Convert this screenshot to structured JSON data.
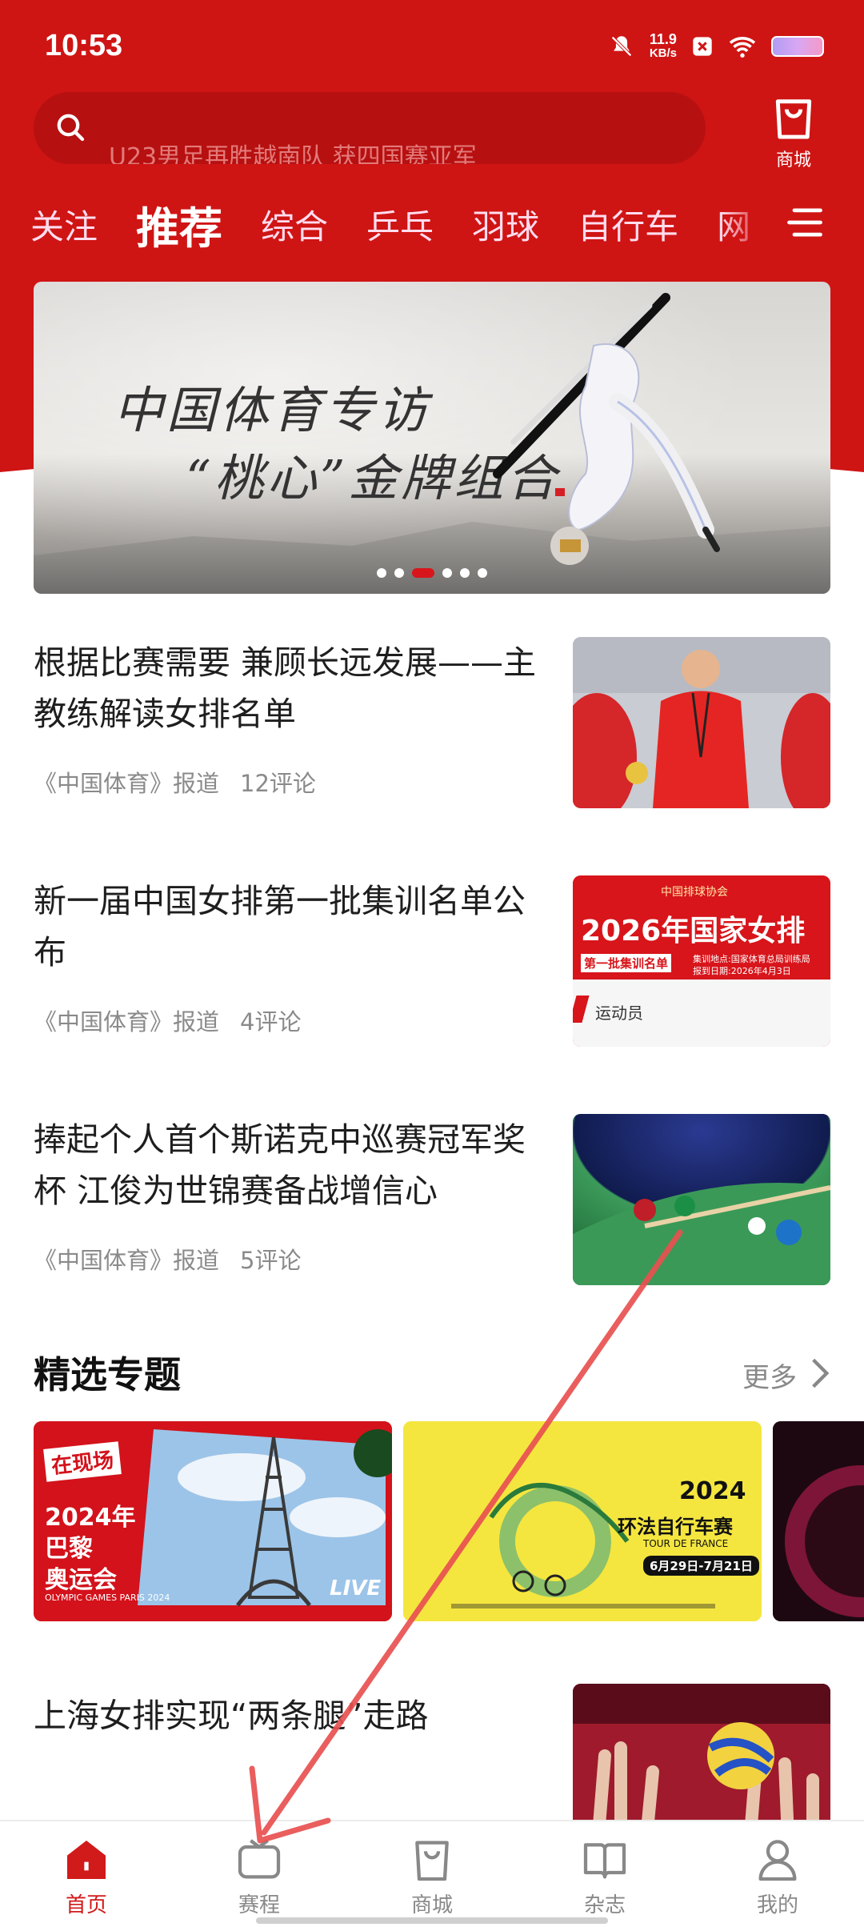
{
  "status_bar": {
    "time": "10:53",
    "net_speed_value": "11.9",
    "net_speed_unit": "KB/s",
    "icons": [
      "mute-icon",
      "network-speed",
      "x-notification-icon",
      "wifi-icon",
      "battery-icon"
    ]
  },
  "search": {
    "placeholder": "U23男足再胜越南队 获四国赛亚军",
    "icon": "search-icon"
  },
  "shop_top": {
    "label": "商城",
    "icon": "shopping-bag-icon"
  },
  "tabs": [
    {
      "label": "关注",
      "active": false
    },
    {
      "label": "推荐",
      "active": true
    },
    {
      "label": "综合",
      "active": false
    },
    {
      "label": "乒乓",
      "active": false
    },
    {
      "label": "羽球",
      "active": false
    },
    {
      "label": "自行车",
      "active": false
    },
    {
      "label": "网",
      "active": false
    }
  ],
  "banner": {
    "line1": "中国体育专访",
    "line2": "“桃心”金牌组合",
    "dots_count": 6,
    "active_dot": 2
  },
  "articles": [
    {
      "title": "根据比赛需要 兼顾长远发展——主教练解读女排名单",
      "source": "《中国体育》报道",
      "comments": "12评论"
    },
    {
      "title": "新一届中国女排第一批集训名单公布",
      "source": "《中国体育》报道",
      "comments": "4评论"
    },
    {
      "title": "捧起个人首个斯诺克中巡赛冠军奖杯 江俊为世锦赛备战增信心",
      "source": "《中国体育》报道",
      "comments": "5评论"
    }
  ],
  "thumb2": {
    "org": "中国排球协会",
    "headline": "2026年国家女排",
    "sub_tag": "第一批集训名单",
    "location": "集训地点:国家体育总局训练局",
    "date": "报到日期:2026年4月3日",
    "athletes_label": "运动员"
  },
  "featured": {
    "title": "精选专题",
    "more": "更多",
    "cards": [
      {
        "tag": "在现场",
        "line1": "2024年",
        "line2": "巴黎",
        "line3": "奥运会",
        "caption": "OLYMPIC GAMES PARIS 2024",
        "badge": "LIVE"
      },
      {
        "year": "2024",
        "name": "环法自行车赛",
        "subtitle": "TOUR DE FRANCE",
        "dates": "6月29日-7月21日"
      },
      {
        "name": ""
      }
    ]
  },
  "article4": {
    "title": "上海女排实现“两条腿”走路"
  },
  "bottom_nav": [
    {
      "label": "首页",
      "icon": "home-icon",
      "active": true
    },
    {
      "label": "赛程",
      "icon": "tv-icon",
      "active": false
    },
    {
      "label": "商城",
      "icon": "shopping-bag-icon",
      "active": false
    },
    {
      "label": "杂志",
      "icon": "book-icon",
      "active": false
    },
    {
      "label": "我的",
      "icon": "person-icon",
      "active": false
    }
  ],
  "colors": {
    "brand_red": "#cf1414",
    "active_nav": "#d11a1a",
    "annotation_arrow": "#e85050"
  }
}
